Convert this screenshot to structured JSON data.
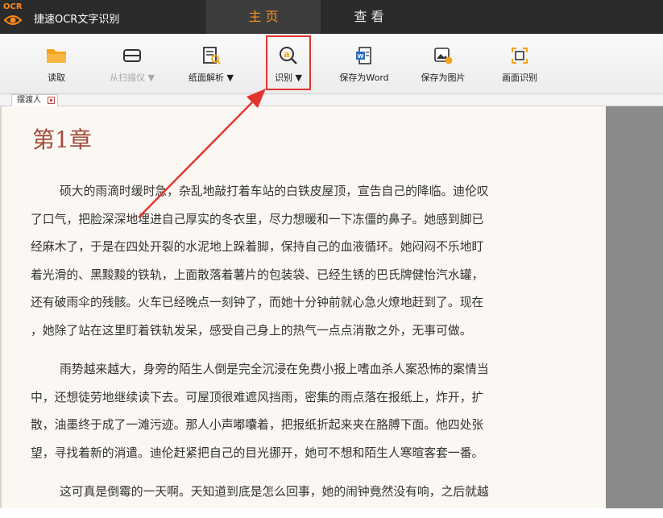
{
  "app": {
    "logo_text": "OCR",
    "title": "捷速OCR文字识别",
    "tabs": [
      {
        "label": "主 页",
        "active": true
      },
      {
        "label": "查 看",
        "active": false
      }
    ]
  },
  "toolbar": {
    "items": [
      {
        "label": "读取",
        "icon": "folder-icon",
        "enabled": true
      },
      {
        "label": "从扫描仪 ▼",
        "icon": "scanner-icon",
        "enabled": false
      },
      {
        "label": "纸面解析 ▼",
        "icon": "page-analyze-icon",
        "enabled": true
      },
      {
        "label": "识别 ▼",
        "icon": "recognize-icon",
        "enabled": true
      },
      {
        "label": "保存为Word",
        "icon": "word-icon",
        "enabled": true
      },
      {
        "label": "保存为图片",
        "icon": "image-icon",
        "enabled": true
      },
      {
        "label": "画面识别",
        "icon": "screen-capture-icon",
        "enabled": true
      }
    ]
  },
  "doc_tab": {
    "label": "摆渡人"
  },
  "document": {
    "chapter_title": "第1章",
    "paragraphs": [
      {
        "lines": [
          "硕大的雨滴时缓时急，杂乱地敲打着车站的白铁皮屋顶，宣告自己的降临。迪伦叹",
          "了口气，把脸深深地埋进自己厚实的冬衣里，尽力想暖和一下冻僵的鼻子。她感到脚已",
          "经麻木了，于是在四处开裂的水泥地上跺着脚，保持自己的血液循环。她闷闷不乐地盯",
          "着光滑的、黑黢黢的铁轨，上面散落着薯片的包装袋、已经生锈的巴氏牌健怡汽水罐，",
          "还有破雨伞的残骸。火车已经晚点一刻钟了，而她十分钟前就心急火燎地赶到了。现在",
          "，她除了站在这里盯着铁轨发呆，感受自己身上的热气一点点消散之外，无事可做。"
        ]
      },
      {
        "lines": [
          "雨势越来越大，身旁的陌生人倒是完全沉浸在免费小报上嗜血杀人案恐怖的案情当",
          "中，还想徒劳地继续读下去。可屋顶很难遮风挡雨，密集的雨点落在报纸上，炸开，扩",
          "散，油墨终于成了一滩污迹。那人小声嘟囔着，把报纸折起来夹在胳膊下面。他四处张",
          "望，寻找着新的消遣。迪伦赶紧把自己的目光挪开，她可不想和陌生人寒暄客套一番。"
        ]
      },
      {
        "lines": [
          "这可真是倒霉的一天啊。天知道到底是怎么回事，她的闹钟竟然没有响，之后就越"
        ]
      }
    ]
  },
  "colors": {
    "title_bar": "#2b2b2b",
    "active_tab_text": "#f7921e",
    "annotation_red": "#e3342f",
    "chapter_title": "#a24a3c"
  }
}
